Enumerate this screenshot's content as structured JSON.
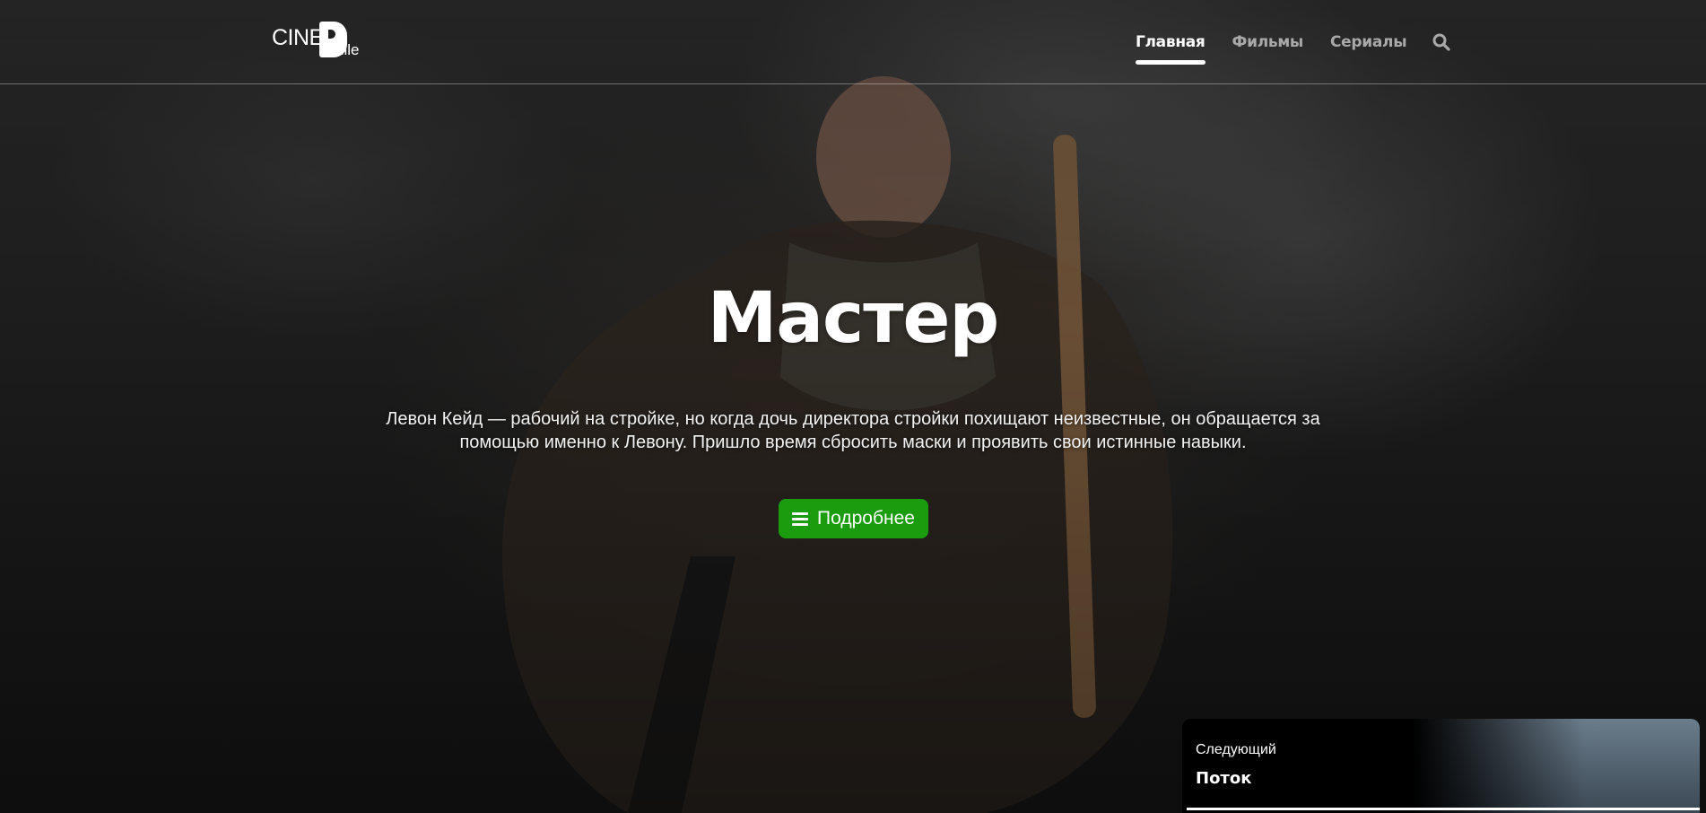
{
  "brand": {
    "logo_text_left": "CINE",
    "logo_text_right": "hile",
    "logo_letter": "P"
  },
  "nav": {
    "items": [
      {
        "label": "Главная",
        "active": true
      },
      {
        "label": "Фильмы",
        "active": false
      },
      {
        "label": "Сериалы",
        "active": false
      }
    ],
    "search_icon": "search-icon"
  },
  "hero": {
    "title": "Мастер",
    "description": "Левон Кейд — рабочий на стройке, но когда дочь директора стройки похищают неизвестные, он обращается за помощью именно к Левону. Пришло время сбросить маски и проявить свои истинные навыки.",
    "more_button": {
      "label": "Подробнее",
      "icon": "menu-icon"
    }
  },
  "next": {
    "label": "Следующий",
    "title": "Поток",
    "progress": 1.0
  },
  "colors": {
    "accent": "#1a9c0e",
    "nav_inactive": "#a9a9a9",
    "background": "#1e1e1e"
  }
}
